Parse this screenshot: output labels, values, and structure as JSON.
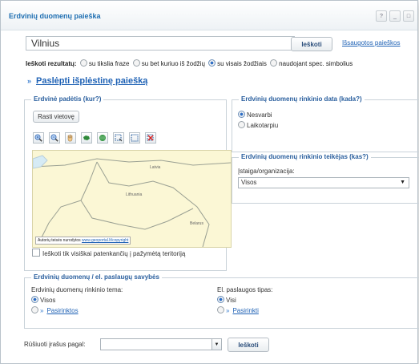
{
  "window": {
    "title": "Erdvinių duomenų paieška",
    "buttons": [
      "?",
      "_",
      "□"
    ]
  },
  "search": {
    "value": "Vilnius",
    "button_label": "Ieškoti",
    "saved_link": "Išsaugotos paieškos"
  },
  "results": {
    "label": "Ieškoti rezultatų:",
    "options": [
      "su tikslia fraze",
      "su bet kuriuo iš žodžių",
      "su visais žodžiais",
      "naudojant spec. simbolius"
    ],
    "selected_index": 2
  },
  "toggle": {
    "label": "Paslėpti išplėstinę paiešką"
  },
  "location": {
    "legend": "Erdvinė padėtis (kur?)",
    "find_button": "Rasti vietovę",
    "map_labels": [
      "Latvia",
      "Lithuania",
      "Belarus"
    ],
    "credit_text": "Autorių teisės nurodytos",
    "credit_link": "www.geoportal.lt/copyright",
    "full_only_label": "Ieškoti tik visiškai patenkančių į pažymėtą teritoriją",
    "tools": [
      "zoom-in-icon",
      "zoom-out-icon",
      "pan-hand-icon",
      "lithuania-map-icon",
      "globe-icon",
      "select-area-icon",
      "select-rectangle-icon",
      "clear-selection-icon"
    ]
  },
  "date": {
    "legend": "Erdvinių duomenų rinkinio data (kada?)",
    "options": [
      "Nesvarbi",
      "Laikotarpiu"
    ],
    "selected_index": 0
  },
  "provider": {
    "legend": "Erdvinių duomenų rinkinio teikėjas (kas?)",
    "label": "Įstaiga/organizacija:",
    "value": "Visos"
  },
  "properties": {
    "legend": "Erdvinių duomenų / el. paslaugų savybės",
    "theme_label": "Erdvinių duomenų rinkinio tema:",
    "theme_all": "Visos",
    "theme_choose": "Pasirinktos",
    "service_label": "El. paslaugos tipas:",
    "service_all": "Visi",
    "service_choose": "Pasirinkti"
  },
  "sort": {
    "label": "Rūšiuoti įrašus pagal:",
    "value": "",
    "button_label": "Ieškoti"
  }
}
